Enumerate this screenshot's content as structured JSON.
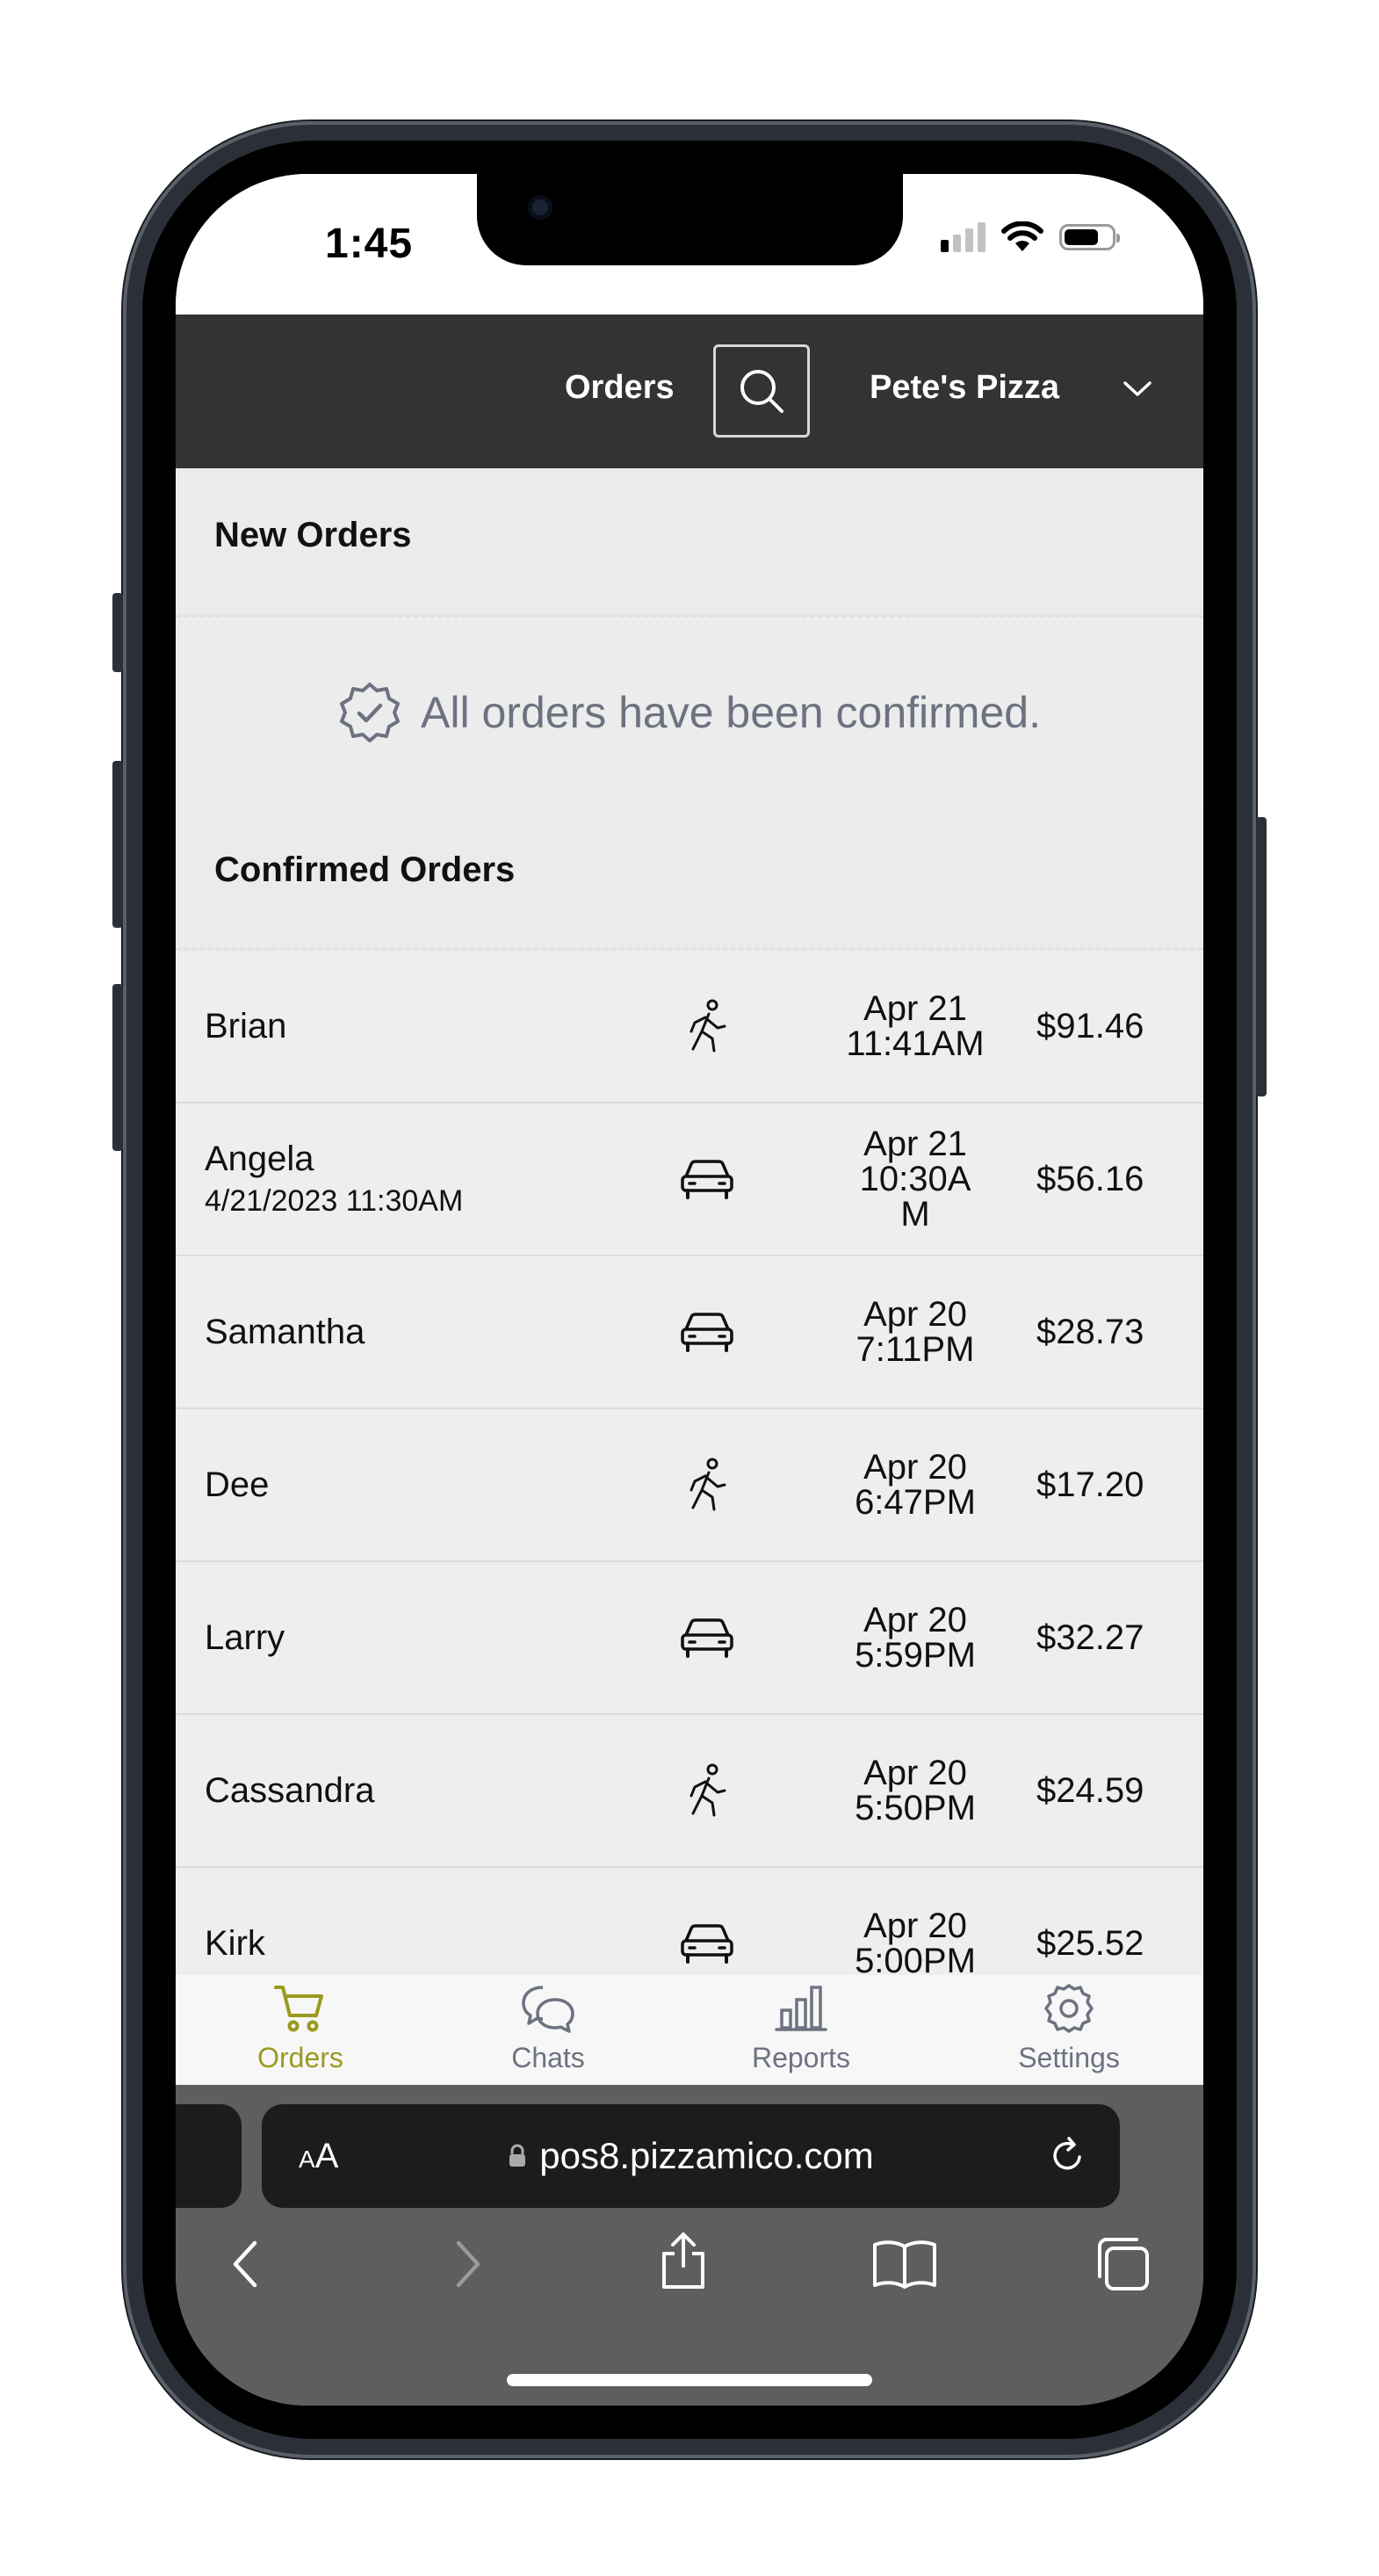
{
  "status_bar": {
    "time": "1:45"
  },
  "app_bar": {
    "title": "Orders",
    "store_name": "Pete's Pizza"
  },
  "new_orders": {
    "title": "New Orders",
    "empty_message": "All orders have been confirmed."
  },
  "confirmed_orders": {
    "title": "Confirmed Orders",
    "rows": [
      {
        "name": "Brian",
        "scheduled": "",
        "type_icon": "walking-person-icon",
        "date": "Apr 21",
        "time": "11:41AM",
        "total": "$91.46"
      },
      {
        "name": "Angela",
        "scheduled": "4/21/2023 11:30AM",
        "type_icon": "car-icon",
        "date": "Apr 21",
        "time": "10:30AM",
        "total": "$56.16"
      },
      {
        "name": "Samantha",
        "scheduled": "",
        "type_icon": "car-icon",
        "date": "Apr 20",
        "time": "7:11PM",
        "total": "$28.73"
      },
      {
        "name": "Dee",
        "scheduled": "",
        "type_icon": "walking-person-icon",
        "date": "Apr 20",
        "time": "6:47PM",
        "total": "$17.20"
      },
      {
        "name": "Larry",
        "scheduled": "",
        "type_icon": "car-icon",
        "date": "Apr 20",
        "time": "5:59PM",
        "total": "$32.27"
      },
      {
        "name": "Cassandra",
        "scheduled": "",
        "type_icon": "walking-person-icon",
        "date": "Apr 20",
        "time": "5:50PM",
        "total": "$24.59"
      },
      {
        "name": "Kirk",
        "scheduled": "",
        "type_icon": "car-icon",
        "date": "Apr 20",
        "time": "5:00PM",
        "total": "$25.52"
      }
    ]
  },
  "tab_bar": {
    "items": [
      {
        "label": "Orders",
        "icon": "cart-icon",
        "active": true
      },
      {
        "label": "Chats",
        "icon": "chat-bubbles-icon",
        "active": false
      },
      {
        "label": "Reports",
        "icon": "bar-chart-icon",
        "active": false
      },
      {
        "label": "Settings",
        "icon": "gear-icon",
        "active": false
      }
    ]
  },
  "browser": {
    "text_size_label": "AA",
    "url": "pos8.pizzamico.com"
  },
  "colors": {
    "app_bar": "#333333",
    "accent_active_tab": "#9a9a1e",
    "muted_text": "#6d7280",
    "list_background": "#eeeeee"
  }
}
